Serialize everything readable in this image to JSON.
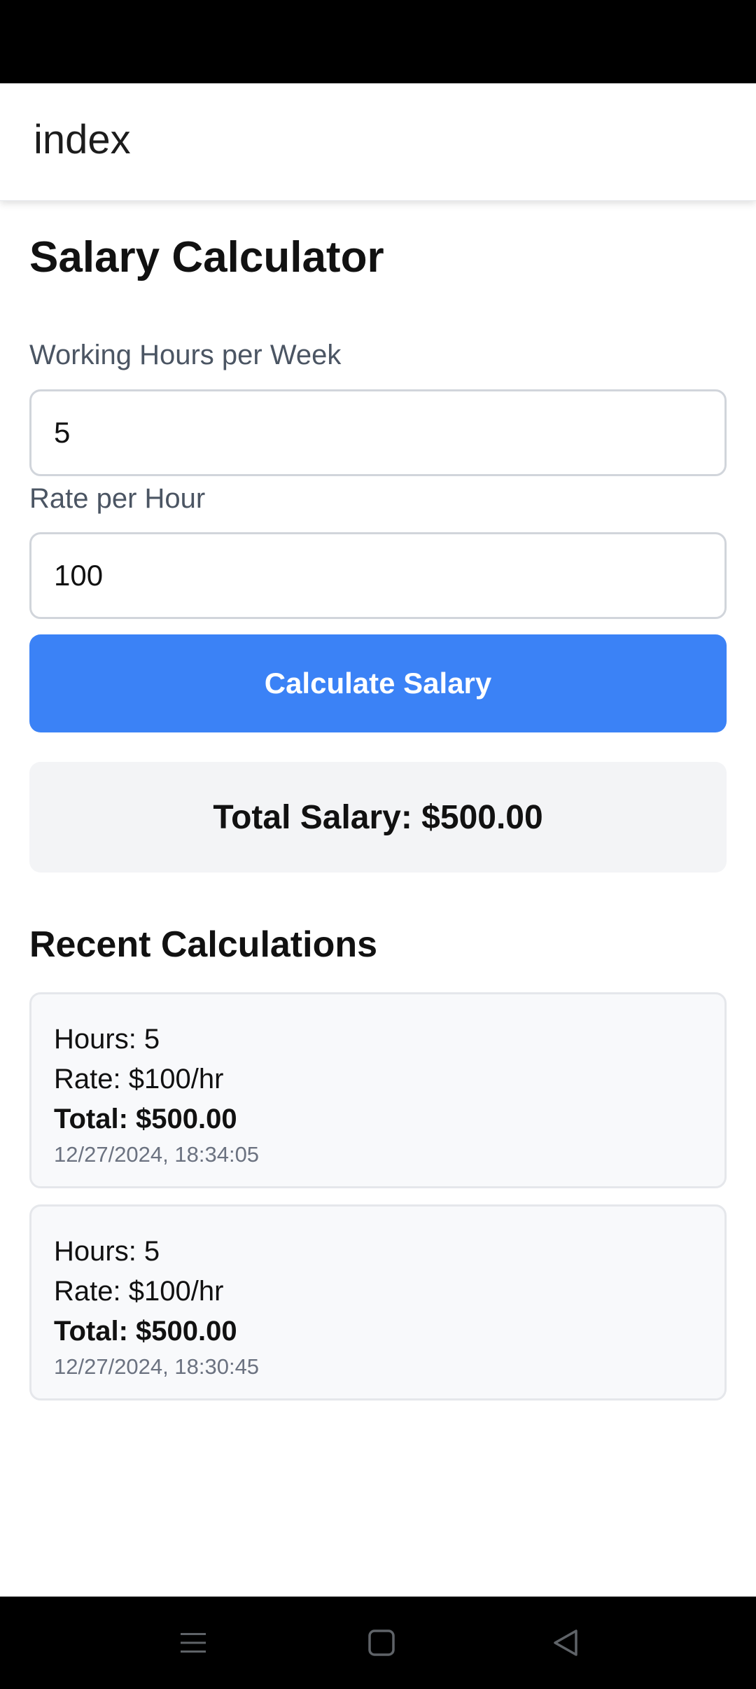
{
  "app": {
    "title": "index"
  },
  "calculator": {
    "title": "Salary Calculator",
    "hours_label": "Working Hours per Week",
    "hours_value": "5",
    "rate_label": "Rate per Hour",
    "rate_value": "100",
    "button_label": "Calculate Salary",
    "result_text": "Total Salary: $500.00"
  },
  "recent": {
    "title": "Recent Calculations",
    "items": [
      {
        "hours": "Hours: 5",
        "rate": "Rate: $100/hr",
        "total": "Total: $500.00",
        "timestamp": "12/27/2024, 18:34:05"
      },
      {
        "hours": "Hours: 5",
        "rate": "Rate: $100/hr",
        "total": "Total: $500.00",
        "timestamp": "12/27/2024, 18:30:45"
      }
    ]
  },
  "navigation": {
    "icons": [
      "menu-icon",
      "home-icon",
      "back-icon"
    ]
  },
  "colors": {
    "accent": "#3b82f6",
    "result_bg": "#f3f4f6",
    "card_bg": "#f8f9fb",
    "label": "#4b5563",
    "muted": "#6b7280"
  }
}
